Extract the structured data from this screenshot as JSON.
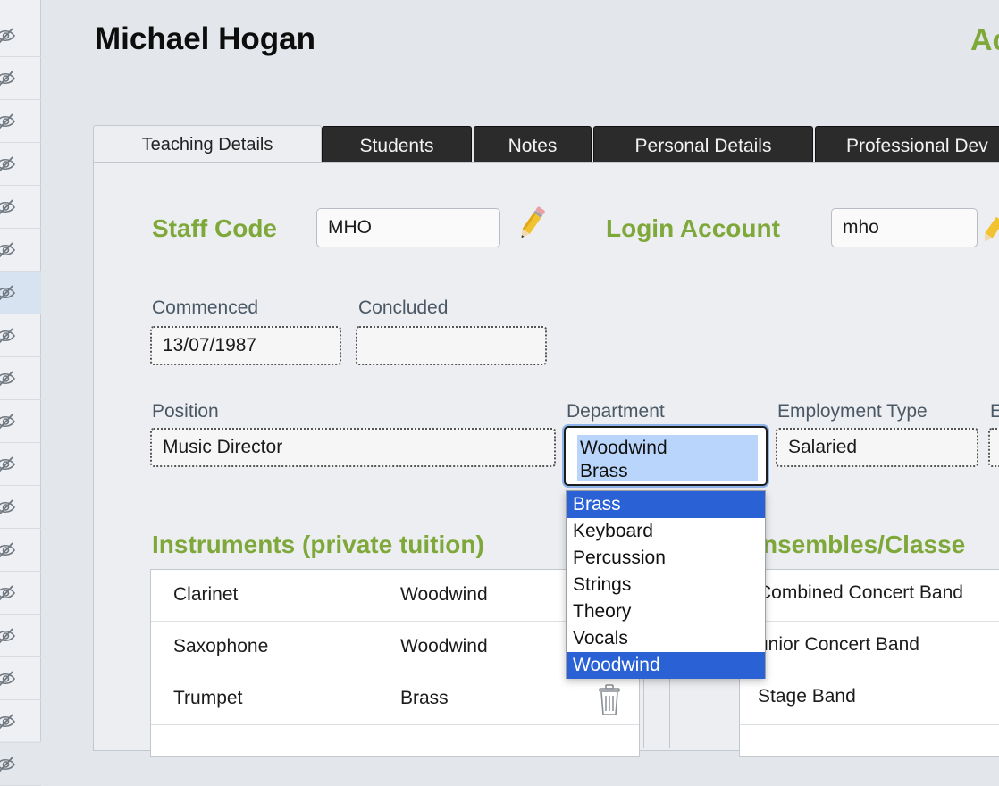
{
  "page": {
    "title": "Michael Hogan",
    "title_right": "Ac"
  },
  "tabs": [
    {
      "label": "Teaching Details",
      "active": true
    },
    {
      "label": "Students",
      "active": false
    },
    {
      "label": "Notes",
      "active": false
    },
    {
      "label": "Personal Details",
      "active": false
    },
    {
      "label": "Professional Dev",
      "active": false
    }
  ],
  "staff_code": {
    "label": "Staff Code",
    "value": "MHO"
  },
  "login_account": {
    "label": "Login Account",
    "value": "mho"
  },
  "commenced": {
    "label": "Commenced",
    "value": "13/07/1987"
  },
  "concluded": {
    "label": "Concluded",
    "value": ""
  },
  "position": {
    "label": "Position",
    "value": "Music Director"
  },
  "department": {
    "label": "Department",
    "selected": [
      "Woodwind",
      "Brass"
    ],
    "options": [
      {
        "label": "Brass",
        "selected": true
      },
      {
        "label": "Keyboard",
        "selected": false
      },
      {
        "label": "Percussion",
        "selected": false
      },
      {
        "label": "Strings",
        "selected": false
      },
      {
        "label": "Theory",
        "selected": false
      },
      {
        "label": "Vocals",
        "selected": false
      },
      {
        "label": "Woodwind",
        "selected": true
      }
    ]
  },
  "employment_type": {
    "label": "Employment Type",
    "value": "Salaried",
    "next_label": "E"
  },
  "instruments": {
    "heading": "Instruments (private tuition)",
    "rows": [
      {
        "instrument": "Clarinet",
        "department": "Woodwind"
      },
      {
        "instrument": "Saxophone",
        "department": "Woodwind"
      },
      {
        "instrument": "Trumpet",
        "department": "Brass"
      }
    ]
  },
  "ensembles": {
    "heading": "nsembles/Classe",
    "rows": [
      {
        "name": "Combined Concert Band"
      },
      {
        "name": "unior Concert Band"
      },
      {
        "name": "Stage Band"
      }
    ]
  },
  "icons": {
    "gutter": "eye-slash-icon",
    "edit": "pencil-icon",
    "delete": "trash-icon"
  },
  "colors": {
    "accent_green": "#7fa83a",
    "tab_dark": "#2b2b2b",
    "selection_blue": "#2a62d5",
    "multi_select_highlight": "#b9d5fb"
  }
}
